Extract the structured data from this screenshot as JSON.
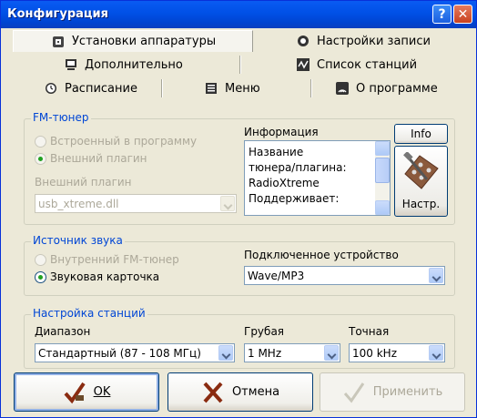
{
  "window": {
    "title": "Конфигурация",
    "help_label": "?",
    "close_label": "✕"
  },
  "tabs": [
    {
      "label": "Установки аппаратуры",
      "icon": "hardware-icon",
      "active": true
    },
    {
      "label": "Настройки записи",
      "icon": "record-icon"
    },
    {
      "label": "Дополнительно",
      "icon": "monitor-icon"
    },
    {
      "label": "Список станций",
      "icon": "stations-list-icon"
    },
    {
      "label": "Расписание",
      "icon": "clock-icon"
    },
    {
      "label": "Меню",
      "icon": "menu-icon"
    },
    {
      "label": "О программе",
      "icon": "radio-waves-icon"
    }
  ],
  "fm_tuner": {
    "title": "FM-тюнер",
    "option_builtin": "Встроенный в программу",
    "option_plugin": "Внешний плагин",
    "plugin_label": "Внешний плагин",
    "plugin_value": "usb_xtreme.dll",
    "info_label": "Информация",
    "info_lines": [
      "Название",
      "тюнера/плагина:",
      "RadioXtreme",
      "Поддерживает:"
    ],
    "info_button": "Info",
    "settings_button": "Настр."
  },
  "sound_source": {
    "title": "Источник звука",
    "option_internal": "Внутренний FM-тюнер",
    "option_soundcard": "Звуковая карточка",
    "device_label": "Подключенное устройство",
    "device_value": "Wave/MP3"
  },
  "stations": {
    "title": "Настройка станций",
    "range_label": "Диапазон",
    "range_value": "Стандартный (87 - 108 МГц)",
    "coarse_label": "Грубая",
    "coarse_value": "1 MHz",
    "fine_label": "Точная",
    "fine_value": "100 kHz"
  },
  "buttons": {
    "ok": "OK",
    "cancel": "Отмена",
    "apply": "Применить"
  }
}
